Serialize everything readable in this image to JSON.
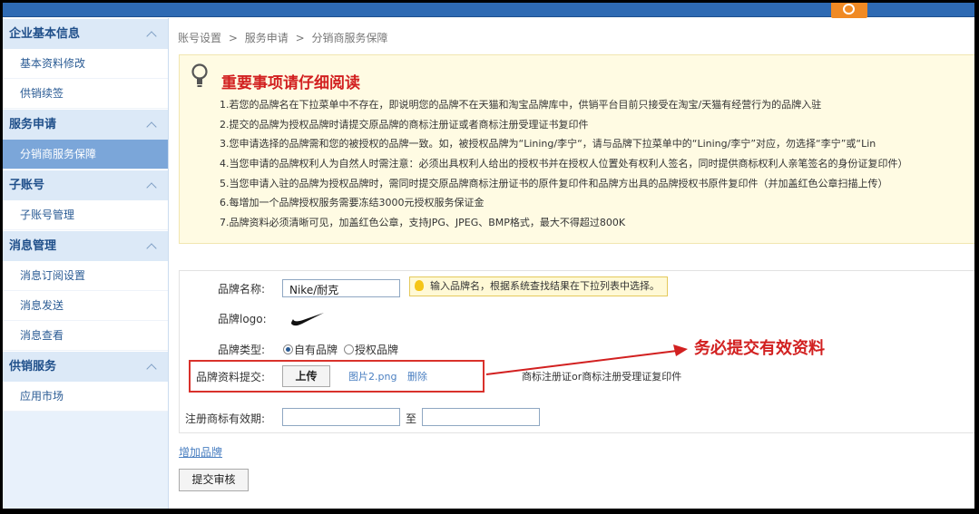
{
  "topbar": {
    "widget_icon": "alarm-clock-icon",
    "colors": {
      "bar": "#2e6ab3",
      "widget": "#f08a24"
    }
  },
  "sidebar": {
    "sections": [
      {
        "label": "企业基本信息",
        "items": [
          "基本资料修改",
          "供销续签"
        ]
      },
      {
        "label": "服务申请",
        "items": [
          "分销商服务保障"
        ]
      },
      {
        "label": "子账号",
        "items": [
          "子账号管理"
        ]
      },
      {
        "label": "消息管理",
        "items": [
          "消息订阅设置",
          "消息发送",
          "消息查看"
        ]
      },
      {
        "label": "供销服务",
        "items": [
          "应用市场"
        ]
      }
    ],
    "active_item": "分销商服务保障"
  },
  "breadcrumb": {
    "items": [
      "账号设置",
      "服务申请",
      "分销商服务保障"
    ],
    "separator": ">"
  },
  "notice": {
    "title": "重要事项请仔细阅读",
    "items": [
      "1.若您的品牌名在下拉菜单中不存在，即说明您的品牌不在天猫和淘宝品牌库中，供销平台目前只接受在淘宝/天猫有经营行为的品牌入驻",
      "2.提交的品牌为授权品牌时请提交原品牌的商标注册证或者商标注册受理证书复印件",
      "3.您申请选择的品牌需和您的被授权的品牌一致。如，被授权品牌为“Lining/李宁“，请与品牌下拉菜单中的“Lining/李宁”对应，勿选择“李宁”或“Lin",
      "4.当您申请的品牌权利人为自然人时需注意：必须出具权利人给出的授权书并在授权人位置处有权利人签名，同时提供商标权利人亲笔签名的身份证复印件）",
      "5.当您申请入驻的品牌为授权品牌时，需同时提交原品牌商标注册证书的原件复印件和品牌方出具的品牌授权书原件复印件（并加盖红色公章扫描上传）",
      "6.每增加一个品牌授权服务需要冻结3000元授权服务保证金",
      "7.品牌资料必须清晰可见，加盖红色公章，支持JPG、JPEG、BMP格式，最大不得超过800K"
    ]
  },
  "form": {
    "brand_name_label": "品牌名称:",
    "brand_name_value": "Nike/耐克",
    "brand_hint": "输入品牌名，根据系统查找结果在下拉列表中选择。",
    "brand_logo_label": "品牌logo:",
    "brand_type_label": "品牌类型:",
    "brand_type_options": [
      "自有品牌",
      "授权品牌"
    ],
    "brand_type_selected": "自有品牌",
    "material_label": "品牌资料提交:",
    "upload_button": "上传",
    "uploaded_file": "图片2.png",
    "delete_link": "删除",
    "material_note": "商标注册证or商标注册受理证复印件",
    "validity_label": "注册商标有效期:",
    "validity_to": "至",
    "validity_start": "",
    "validity_end": ""
  },
  "add_brand_link": "增加品牌",
  "submit_button": "提交审核",
  "annotation": {
    "text": "务必提交有效资料",
    "color": "#d22020"
  }
}
